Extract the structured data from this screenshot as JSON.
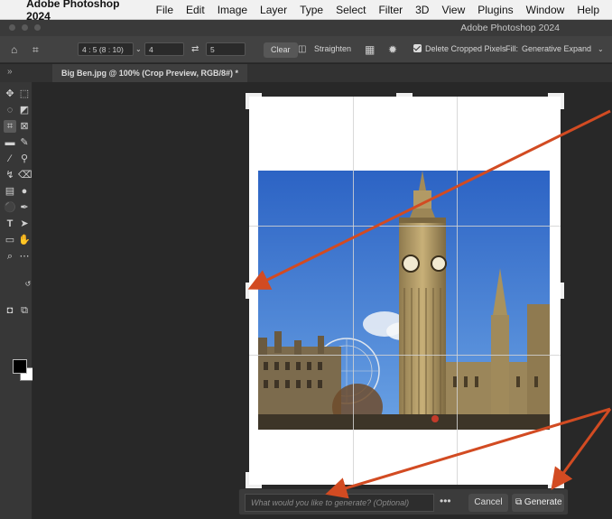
{
  "menubar": {
    "apple": "",
    "app_name": "Adobe Photoshop 2024",
    "items": [
      "File",
      "Edit",
      "Image",
      "Layer",
      "Type",
      "Select",
      "Filter",
      "3D",
      "View",
      "Plugins",
      "Window",
      "Help"
    ]
  },
  "window": {
    "title": "Adobe Photoshop 2024"
  },
  "options_bar": {
    "ratio_preset": "4 : 5 (8 : 10)",
    "width_value": "4",
    "height_value": "5",
    "clear_label": "Clear",
    "straighten_label": "Straighten",
    "delete_cropped_label": "Delete Cropped Pixels",
    "delete_cropped_checked": true,
    "fill_label": "Fill:",
    "fill_value": "Generative Expand"
  },
  "document_tab": {
    "label": "Big Ben.jpg @ 100% (Crop Preview, RGB/8#) *"
  },
  "generative_bar": {
    "prompt_placeholder": "What would you like to generate? (Optional)",
    "more_label": "•••",
    "cancel_label": "Cancel",
    "generate_label": "Generate"
  },
  "colors": {
    "annotation_arrow": "#d24b22",
    "foreground": "#000000",
    "background": "#ffffff",
    "ui_panel": "#373737",
    "sky": "#2f6fd0"
  }
}
